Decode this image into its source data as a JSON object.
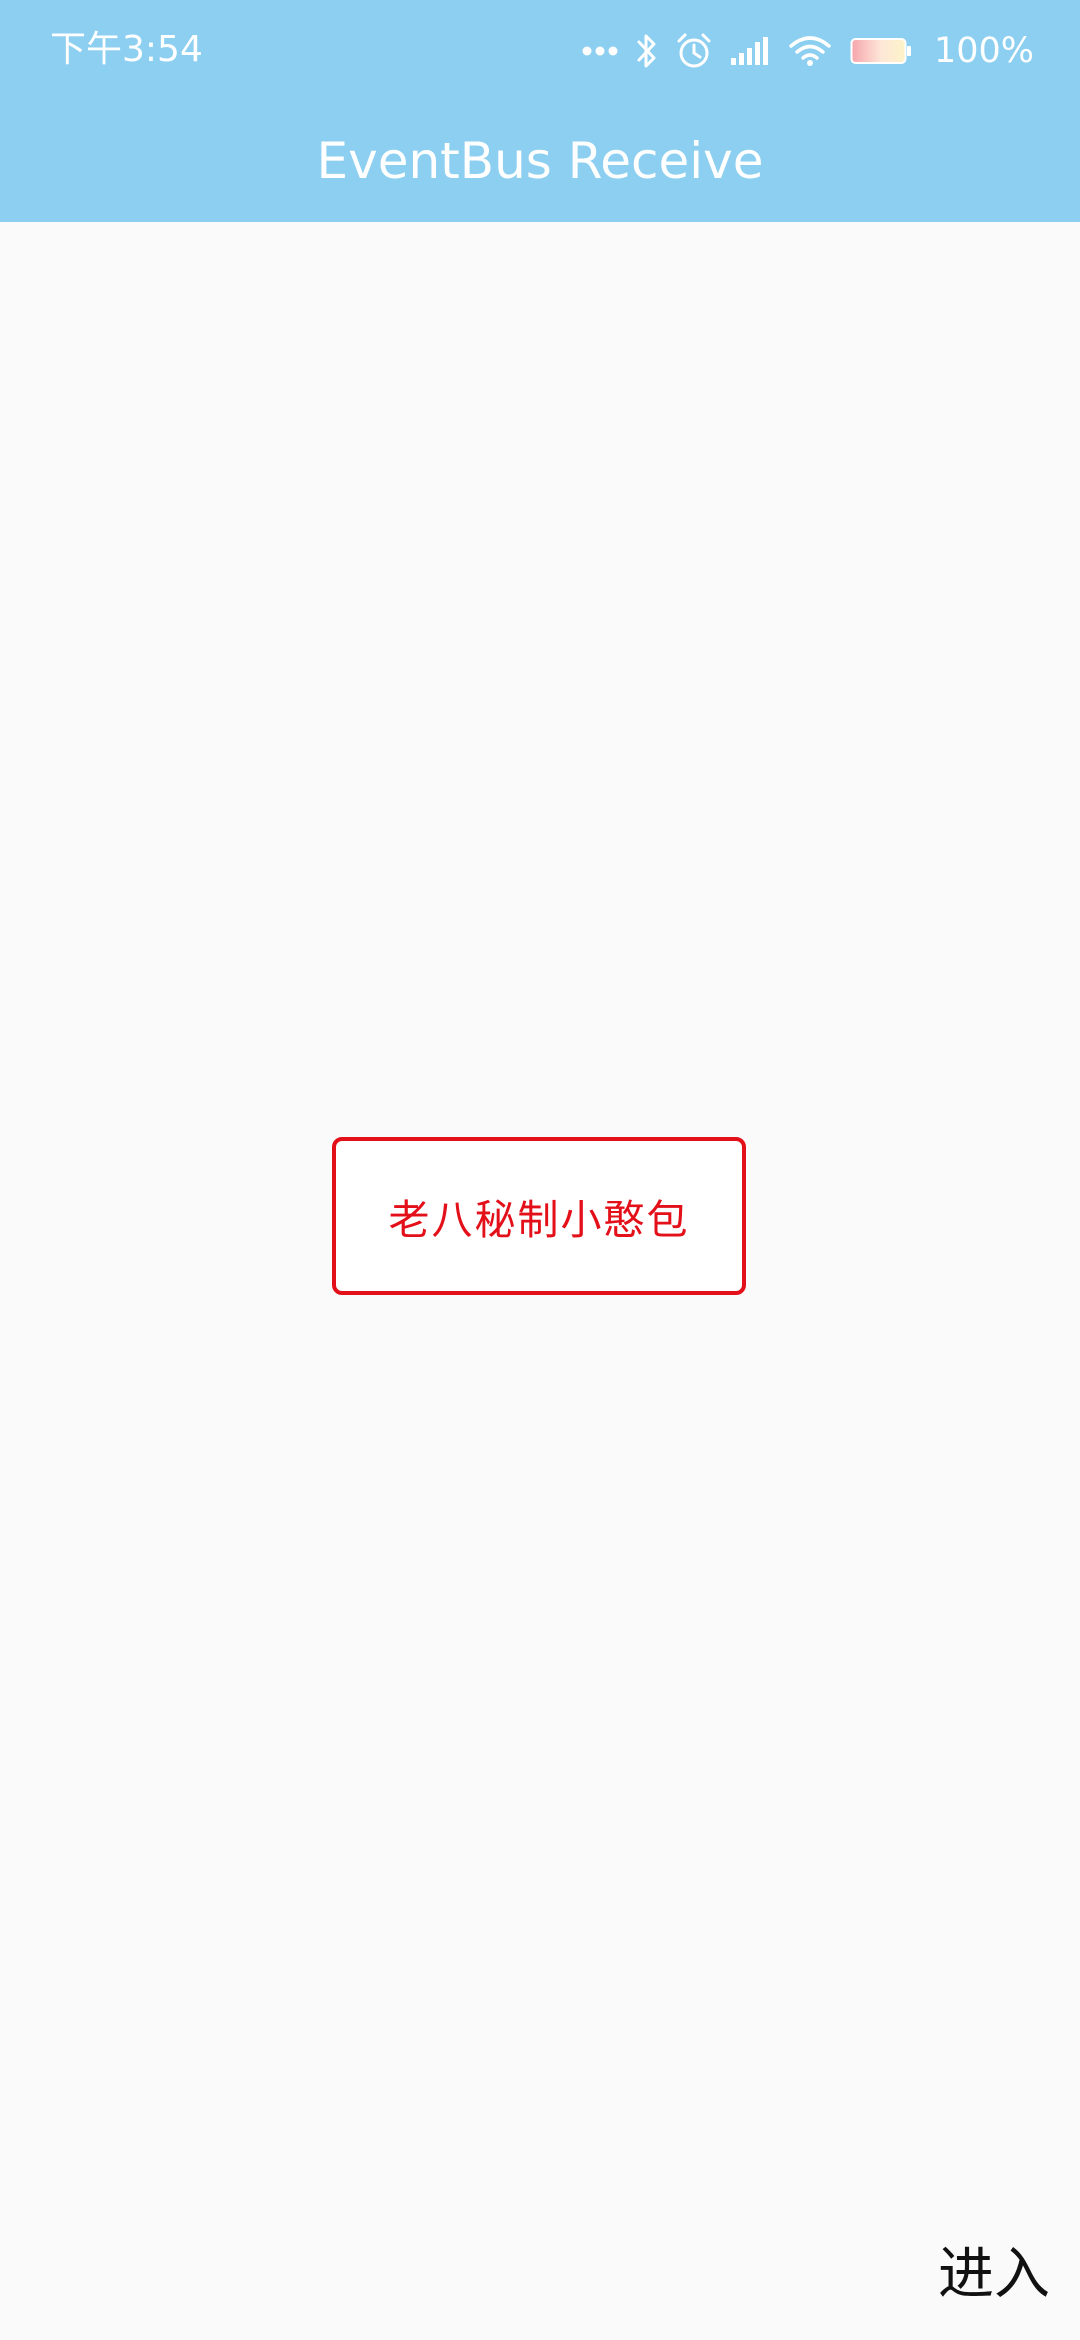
{
  "status_bar": {
    "time": "下午3:54",
    "battery_percent": "100%",
    "icons": [
      "more-dots-icon",
      "bluetooth-icon",
      "alarm-icon",
      "signal-icon",
      "wifi-icon",
      "battery-icon"
    ]
  },
  "app_bar": {
    "title": "EventBus Receive",
    "color": "#8ccff0"
  },
  "main": {
    "center_button_label": "老八秘制小憨包",
    "accent_color": "#e3101a"
  },
  "footer": {
    "enter_label": "进入"
  }
}
